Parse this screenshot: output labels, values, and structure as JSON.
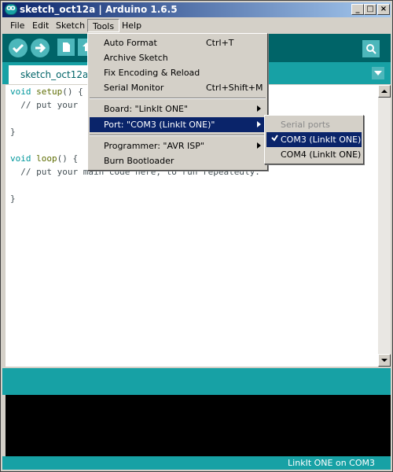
{
  "window": {
    "title": "sketch_oct12a | Arduino 1.6.5",
    "logo_text": "oo",
    "controls": {
      "minimize": "_",
      "maximize": "□",
      "close": "×"
    }
  },
  "menubar": {
    "items": [
      "File",
      "Edit",
      "Sketch",
      "Tools",
      "Help"
    ]
  },
  "toolbar": {
    "buttons": [
      "verify-icon",
      "upload-icon",
      "new-icon",
      "open-icon",
      "serial-monitor-icon"
    ]
  },
  "tabs": {
    "active": "sketch_oct12a"
  },
  "editor": {
    "lines": [
      "void setup() {",
      "  // put your",
      "",
      "}",
      "",
      "void loop() {",
      "  // put your main code here, to run repeatedly:",
      "",
      "}"
    ]
  },
  "status": {
    "board_port": "LinkIt ONE on COM3"
  },
  "tools_menu": {
    "items": [
      {
        "label": "Auto Format",
        "shortcut": "Ctrl+T"
      },
      {
        "label": "Archive Sketch",
        "shortcut": ""
      },
      {
        "label": "Fix Encoding & Reload",
        "shortcut": ""
      },
      {
        "label": "Serial Monitor",
        "shortcut": "Ctrl+Shift+M"
      },
      {
        "label": "Board: \"LinkIt ONE\"",
        "submenu": true
      },
      {
        "label": "Port: \"COM3 (LinkIt ONE)\"",
        "submenu": true,
        "selected": true
      },
      {
        "label": "Programmer: \"AVR ISP\"",
        "submenu": true
      },
      {
        "label": "Burn Bootloader",
        "shortcut": ""
      }
    ]
  },
  "port_submenu": {
    "header": "Serial ports",
    "items": [
      {
        "label": "COM3 (LinkIt ONE)",
        "checked": true,
        "selected": true
      },
      {
        "label": "COM4 (LinkIt ONE)",
        "checked": false
      }
    ]
  },
  "colors": {
    "teal_dark": "#006468",
    "teal": "#17a1a5",
    "teal_light": "#4db7bb",
    "menu_highlight": "#0a246a"
  }
}
